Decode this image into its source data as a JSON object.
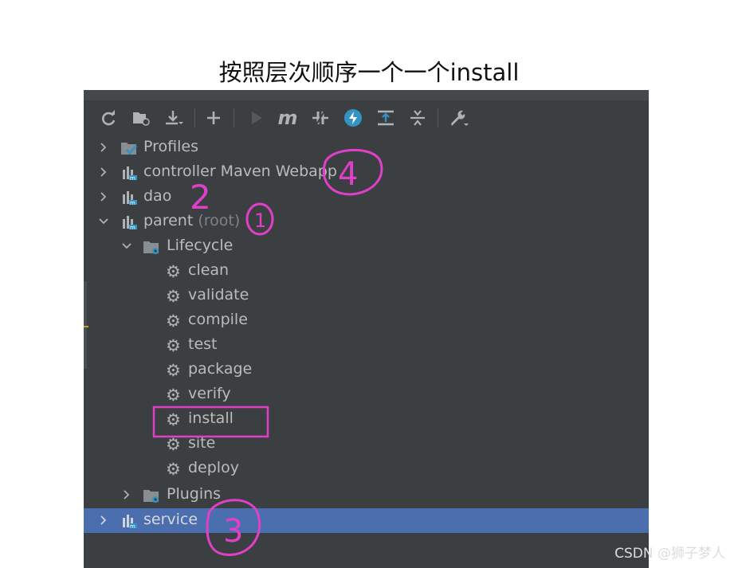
{
  "caption": "按照层次顺序一个一个install",
  "toolbar": {
    "buttons": [
      {
        "name": "reimport-icon",
        "glyph": "⟳"
      },
      {
        "name": "generate-sources-icon",
        "glyph": "📁"
      },
      {
        "name": "download-icon",
        "glyph": "⤓"
      },
      {
        "name": "add-icon",
        "glyph": "+"
      },
      {
        "name": "run-icon",
        "glyph": "▶"
      },
      {
        "name": "execute-goal-icon",
        "glyph": "m"
      },
      {
        "name": "toggle-offline-icon",
        "glyph": "⫽"
      },
      {
        "name": "skip-tests-icon",
        "glyph": "ϟ"
      },
      {
        "name": "show-dependencies-icon",
        "glyph": "⊤"
      },
      {
        "name": "collapse-all-icon",
        "glyph": "÷"
      },
      {
        "name": "settings-wrench-icon",
        "glyph": "🔧"
      }
    ]
  },
  "tree": {
    "profiles": "Profiles",
    "controller": "controller Maven Webapp",
    "dao": "dao",
    "parent": "parent",
    "parent_suffix": "(root)",
    "lifecycle": "Lifecycle",
    "goals": [
      "clean",
      "validate",
      "compile",
      "test",
      "package",
      "verify",
      "install",
      "site",
      "deploy"
    ],
    "plugins": "Plugins",
    "service": "service"
  },
  "annotations": {
    "n1": "1",
    "n2": "2",
    "n3": "3",
    "n4": "4"
  },
  "colors": {
    "panel_bg": "#3c3f41",
    "selected_row": "#4b6eaf",
    "text": "#bbbbbb",
    "annotation": "#e040c8"
  },
  "watermark": "CSDN @狮子梦人"
}
